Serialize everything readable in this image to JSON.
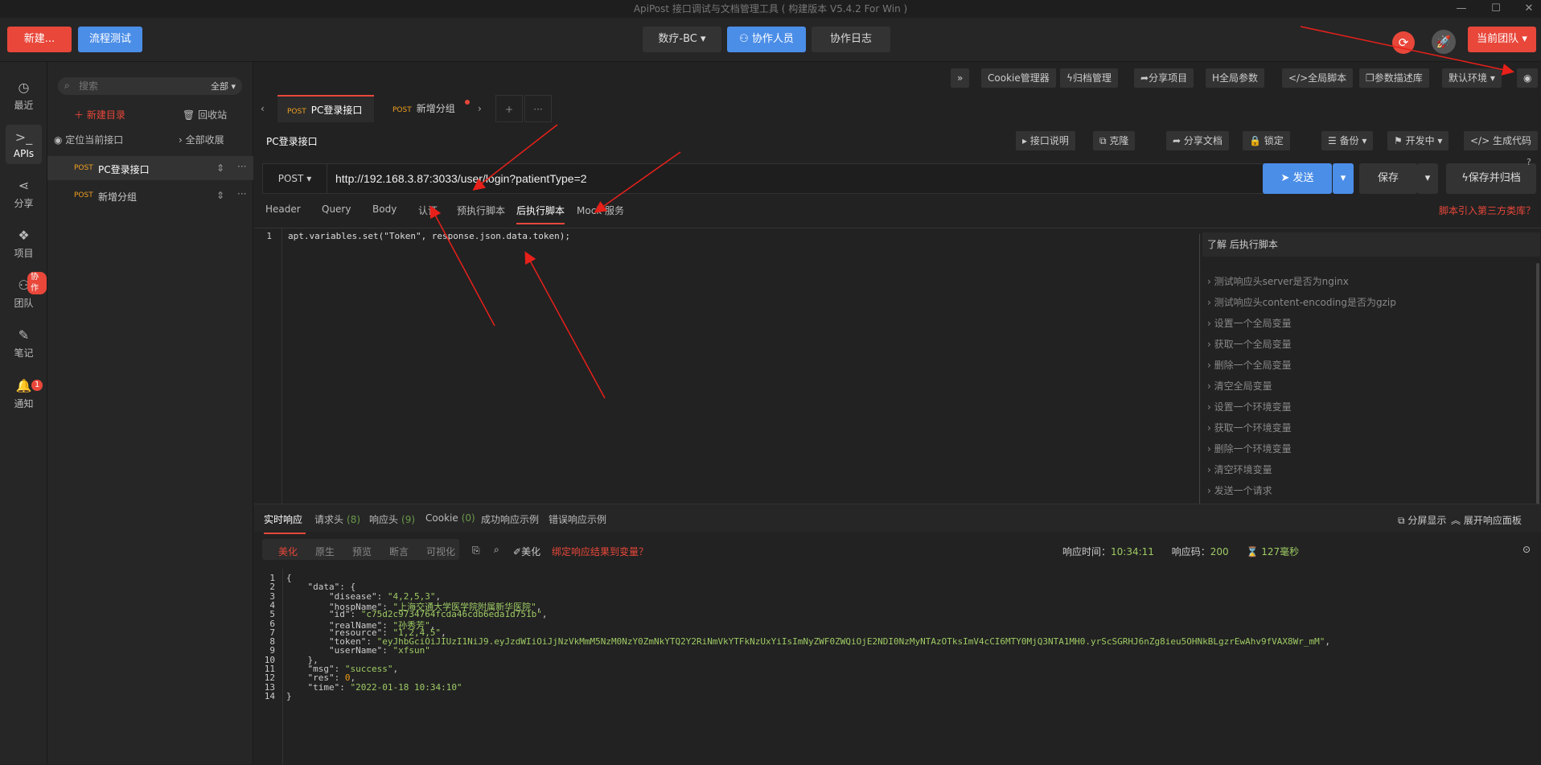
{
  "window": {
    "title": "ApiPost 接口调试与文档管理工具 ( 构建版本 V5.4.2 For Win )",
    "minimize": "—",
    "maximize": "☐",
    "close": "✕"
  },
  "topbar": {
    "new_label": "新建...",
    "flow_label": "流程测试",
    "project": "数疗-BC",
    "collab_label": "协作人员",
    "log_label": "协作日志",
    "team_label": "当前团队"
  },
  "nav": {
    "recent": "最近",
    "apis": "APIs",
    "share": "分享",
    "project": "项目",
    "team": "团队",
    "team_badge": "协作",
    "notes": "笔记",
    "notify": "通知",
    "notify_badge": "1"
  },
  "tree": {
    "search_placeholder": "搜索",
    "filter": "全部",
    "new_dir": "新建目录",
    "recycle": "回收站",
    "locate": "定位当前接口",
    "collapse": "全部收展",
    "items": [
      {
        "method": "POST",
        "name": "PC登录接口"
      },
      {
        "method": "POST",
        "name": "新增分组"
      }
    ]
  },
  "toolbar": {
    "more": "»",
    "cookie": "Cookie管理器",
    "archive": "归档管理",
    "share": "分享项目",
    "global_params": "全局参数",
    "global_script": "全局脚本",
    "param_lib": "参数描述库",
    "env": "默认环境"
  },
  "tabs": [
    {
      "method": "POST",
      "name": "PC登录接口"
    },
    {
      "method": "POST",
      "name": "新增分组"
    }
  ],
  "tab_controls": {
    "prev": "‹",
    "next": "›",
    "add": "+",
    "more": "···"
  },
  "request": {
    "name": "PC登录接口",
    "doc": "接口说明",
    "clone": "克隆",
    "share_doc": "分享文档",
    "lock": "锁定",
    "backup": "备份",
    "status": "开发中",
    "gen_code": "生成代码",
    "method": "POST",
    "url": "http://192.168.3.87:3033/user/login?patientType=2",
    "send": "发送",
    "save": "保存",
    "save_archive": "保存并归档"
  },
  "subtabs": [
    "Header",
    "Query",
    "Body",
    "认证",
    "预执行脚本",
    "后执行脚本",
    "Mock 服务"
  ],
  "active_subtab": "后执行脚本",
  "third_party_link": "脚本引入第三方类库？",
  "script": {
    "line": "1",
    "code": "apt.variables.set(\"Token\", response.json.data.token);"
  },
  "snippets": {
    "title": "了解 后执行脚本",
    "items": [
      "测试响应头server是否为nginx",
      "测试响应头content-encoding是否为gzip",
      "设置一个全局变量",
      "获取一个全局变量",
      "删除一个全局变量",
      "清空全局变量",
      "设置一个环境变量",
      "获取一个环境变量",
      "删除一个环境变量",
      "清空环境变量",
      "发送一个请求"
    ]
  },
  "response": {
    "tabs": [
      {
        "label": "实时响应",
        "count": ""
      },
      {
        "label": "请求头",
        "count": "(8)"
      },
      {
        "label": "响应头",
        "count": "(9)"
      },
      {
        "label": "Cookie",
        "count": "(0)"
      },
      {
        "label": "成功响应示例",
        "count": ""
      },
      {
        "label": "错误响应示例",
        "count": ""
      }
    ],
    "split": "分屏显示",
    "expand": "展开响应面板",
    "views": [
      "美化",
      "原生",
      "预览",
      "断言",
      "可视化"
    ],
    "beautify": "美化",
    "bind_link": "绑定响应结果到变量？",
    "time_label": "响应时间：",
    "time_value": "10:34:11",
    "code_label": "响应码：",
    "code_value": "200",
    "duration": "127毫秒",
    "json_lines": [
      "{",
      "    \"data\": {",
      "        \"disease\": \"4,2,5,3\",",
      "        \"hospName\": \"上海交通大学医学院附属新华医院\",",
      "        \"id\": \"c75d2c9734764fcda46cdb6eda1d751b\",",
      "        \"realName\": \"孙秀芳\",",
      "        \"resource\": \"1,2,4,5\",",
      "        \"token\": \"eyJhbGciOiJIUzI1NiJ9.eyJzdWIiOiJjNzVkMmM5NzM0NzY0ZmNkYTQ2Y2RiNmVkYTFkNzUxYiIsImNyZWF0ZWQiOjE2NDI0NzMyNTAzOTksImV4cCI6MTY0MjQ3NTA1MH0.yrScSGRHJ6nZg8ieu5OHNkBLgzrEwAhv9fVAX8Wr_mM\",",
      "        \"userName\": \"xfsun\"",
      "    },",
      "    \"msg\": \"success\",",
      "    \"res\": 0,",
      "    \"time\": \"2022-01-18 10:34:10\"",
      "}"
    ]
  },
  "colors": {
    "accent": "#e8473a",
    "blue": "#4b8ee8",
    "green": "#9ecb64"
  }
}
